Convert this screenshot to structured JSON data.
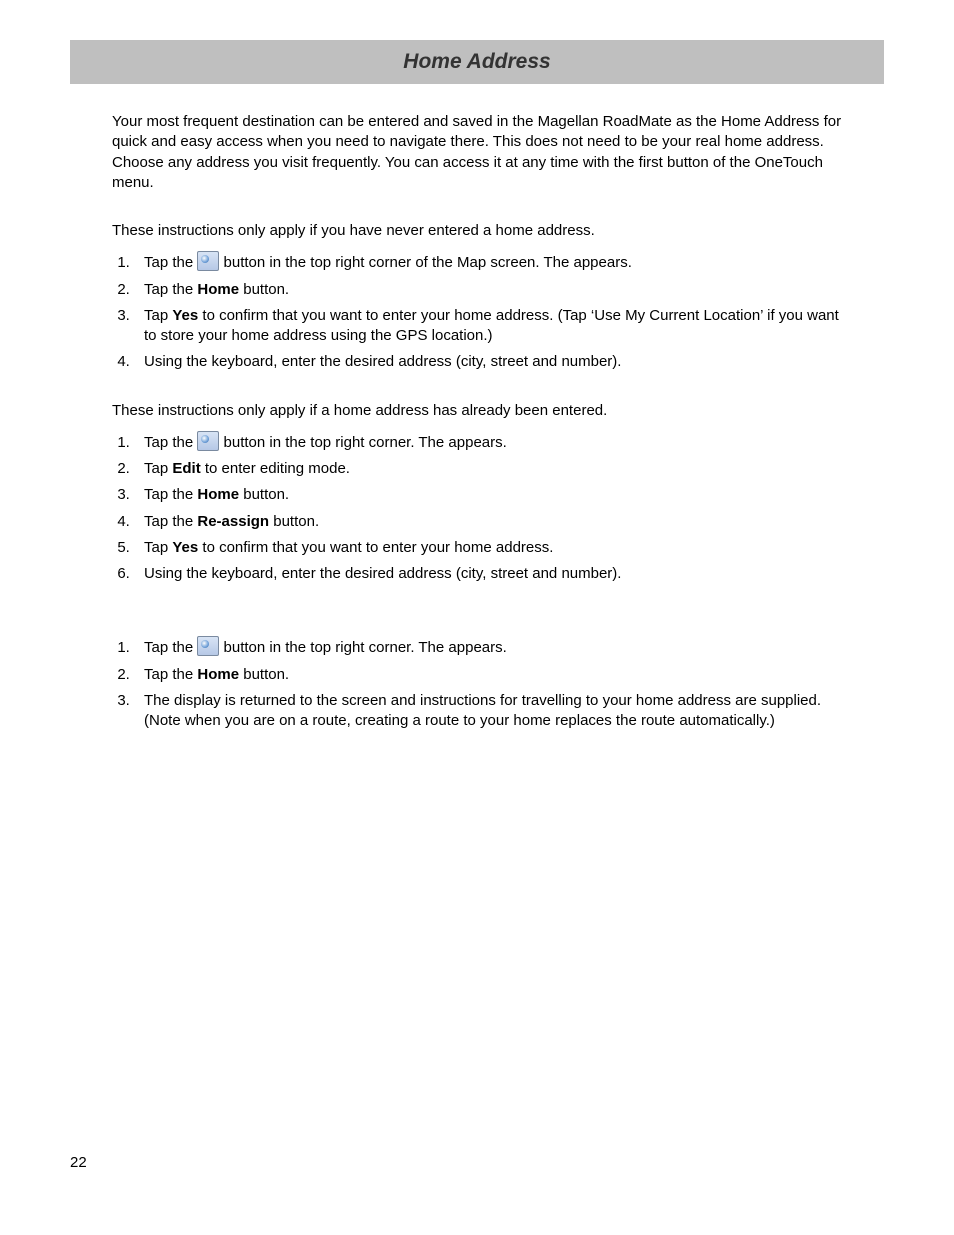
{
  "title": "Home Address",
  "page_number": "22",
  "intro": "Your most frequent destination can be entered and saved in the Magellan RoadMate as the Home Address for quick and easy access when you need to navigate there. This does not need to be your real home address. Choose any address you visit frequently. You can access it at any time with the first button of the OneTouch menu.",
  "section1": {
    "note": "These instructions only apply if you have never entered a home address.",
    "steps": {
      "s1a": "Tap the ",
      "s1b": " button in the top right corner of the Map screen. The ",
      "s1c": " appears.",
      "s2a": "Tap the ",
      "s2b": "Home",
      "s2c": " button.",
      "s3a": "Tap ",
      "s3b": "Yes",
      "s3c": " to confirm that you want to enter your home address.  (Tap ‘Use My Current Location’ if you want to store your home address using the GPS location.)",
      "s4": "Using the keyboard, enter the desired address (city, street and number)."
    }
  },
  "section2": {
    "note": "These instructions only apply if a home address has already been entered.",
    "steps": {
      "s1a": "Tap the ",
      "s1b": " button in the top right corner. The ",
      "s1c": " appears.",
      "s2a": "Tap ",
      "s2b": "Edit",
      "s2c": " to enter editing mode.",
      "s3a": "Tap the ",
      "s3b": "Home",
      "s3c": " button.",
      "s4a": "Tap the ",
      "s4b": "Re-assign",
      "s4c": " button.",
      "s5a": "Tap ",
      "s5b": "Yes",
      "s5c": " to confirm that you want to enter your home address.",
      "s6": "Using the keyboard, enter the desired address (city, street and number)."
    }
  },
  "section3": {
    "steps": {
      "s1a": "Tap the ",
      "s1b": " button in the top right corner. The ",
      "s1c": " appears.",
      "s2a": "Tap the ",
      "s2b": "Home",
      "s2c": " button.",
      "s3a": "The display is returned to the ",
      "s3b": " screen and instructions for travelling to your home address are supplied.  (Note when you are on a route, creating a route to your home replaces the route automatically.)"
    }
  }
}
